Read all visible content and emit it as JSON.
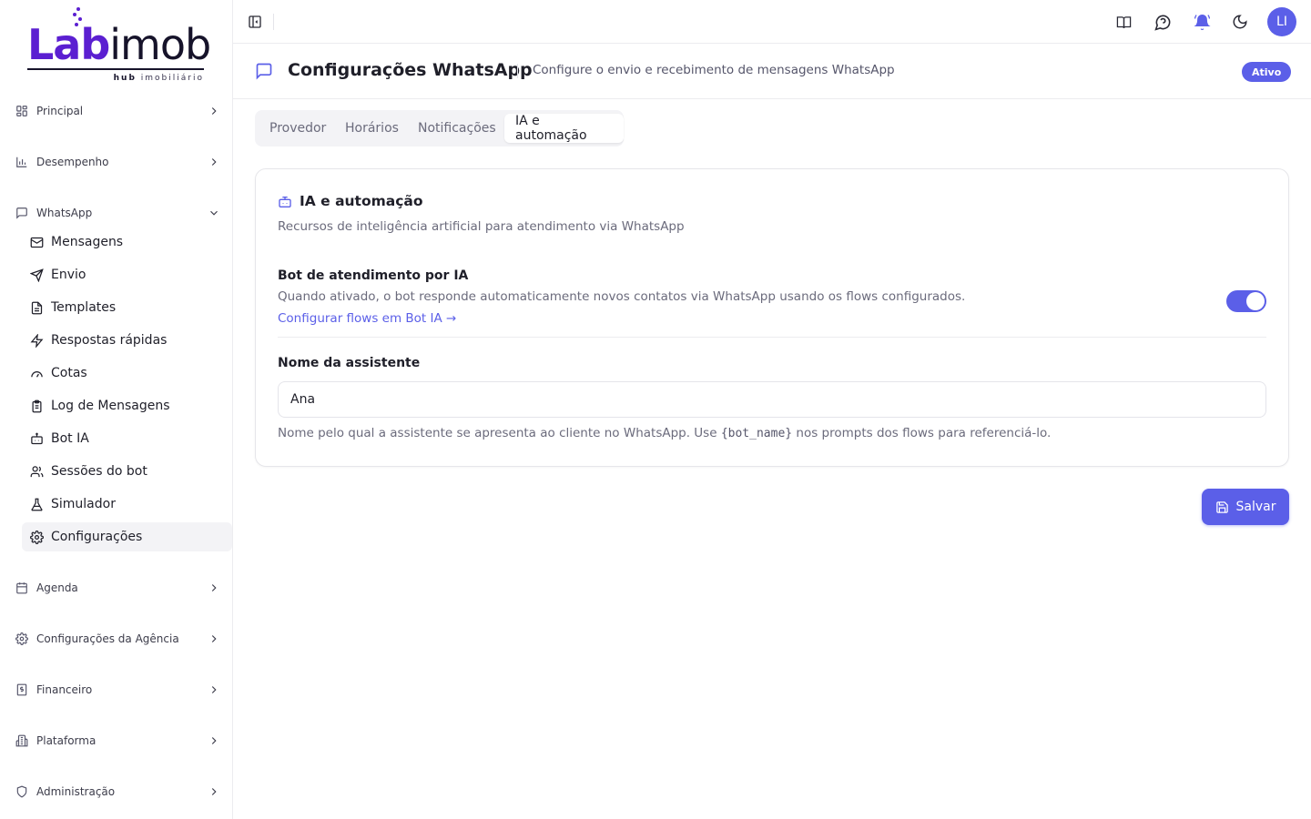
{
  "brand": {
    "logo_text_lab": "Lab",
    "logo_text_imob": "imob",
    "logo_sub_bold": "hub",
    "logo_sub_rest": "imobiliário",
    "color": "#5b1fd1"
  },
  "sidebar": {
    "groups": [
      {
        "label": "Principal",
        "icon": "grid-icon"
      },
      {
        "label": "Desempenho",
        "icon": "bar-chart-icon"
      },
      {
        "label": "WhatsApp",
        "icon": "message-square-icon",
        "expanded": true
      },
      {
        "label": "Agenda",
        "icon": "calendar-icon"
      },
      {
        "label": "Configurações da Agência",
        "icon": "settings-icon"
      },
      {
        "label": "Financeiro",
        "icon": "receipt-icon"
      },
      {
        "label": "Plataforma",
        "icon": "building-icon"
      },
      {
        "label": "Administração",
        "icon": "shield-icon"
      }
    ],
    "whatsapp_items": [
      {
        "label": "Mensagens",
        "icon": "mail-icon"
      },
      {
        "label": "Envio",
        "icon": "send-icon"
      },
      {
        "label": "Templates",
        "icon": "file-text-icon"
      },
      {
        "label": "Respostas rápidas",
        "icon": "zap-icon"
      },
      {
        "label": "Cotas",
        "icon": "gauge-icon"
      },
      {
        "label": "Log de Mensagens",
        "icon": "clipboard-list-icon"
      },
      {
        "label": "Bot IA",
        "icon": "bot-icon"
      },
      {
        "label": "Sessões do bot",
        "icon": "users-icon"
      },
      {
        "label": "Simulador",
        "icon": "flask-icon"
      },
      {
        "label": "Configurações",
        "icon": "settings-icon",
        "active": true
      }
    ]
  },
  "topbar": {
    "icons": [
      "book-open-icon",
      "message-help-icon",
      "bell-ring-icon",
      "moon-icon"
    ],
    "avatar_initials": "LI"
  },
  "page": {
    "title": "Configurações WhatsApp",
    "description": "Configure o envio e recebimento de mensagens WhatsApp",
    "status_badge": "Ativo"
  },
  "tabs": [
    {
      "label": "Provedor"
    },
    {
      "label": "Horários"
    },
    {
      "label": "Notificações"
    },
    {
      "label": "IA e automação",
      "active": true
    }
  ],
  "card": {
    "title": "IA e automação",
    "description": "Recursos de inteligência artificial para atendimento via WhatsApp",
    "bot_setting": {
      "label": "Bot de atendimento por IA",
      "description": "Quando ativado, o bot responde automaticamente novos contatos via WhatsApp usando os flows configurados.",
      "link": "Configurar flows em Bot IA →",
      "enabled": true
    },
    "assistant_name": {
      "label": "Nome da assistente",
      "value": "Ana",
      "help_before": "Nome pelo qual a assistente se apresenta ao cliente no WhatsApp. Use",
      "help_code": "{bot_name}",
      "help_after": "nos prompts dos flows para referenciá-lo."
    }
  },
  "actions": {
    "save_label": "Salvar"
  },
  "colors": {
    "accent": "#5b5fe8",
    "muted_text": "#6b6b7c"
  }
}
